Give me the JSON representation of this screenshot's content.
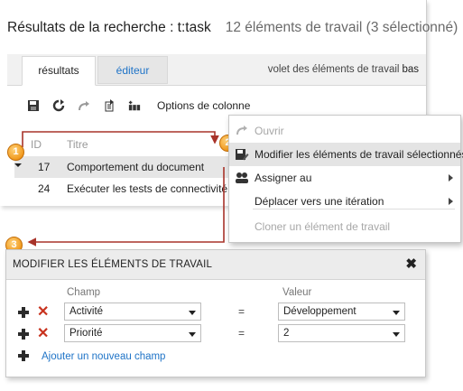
{
  "search": {
    "title": "Résultats de la recherche : t:task",
    "count": "12 éléments de travail (3 sélectionné)",
    "tabs": [
      {
        "label": "résultats"
      },
      {
        "label": "éditeur"
      }
    ],
    "pane_label": "volet des éléments de travail",
    "pane_value": "bas",
    "toolbar": {
      "column_options_label": "Options de colonne"
    },
    "grid": {
      "headers": {
        "id": "ID",
        "title": "Titre"
      },
      "rows": [
        {
          "id": "17",
          "title": "Comportement du document"
        },
        {
          "id": "24",
          "title": "Exécuter les tests de connectivité"
        }
      ]
    }
  },
  "callouts": [
    "1",
    "2",
    "3"
  ],
  "context_menu": {
    "items": [
      {
        "label": "Ouvrir",
        "icon": "open-icon"
      },
      {
        "label": "Modifier les éléments de travail sélectionnés...",
        "icon": "save-edit-icon"
      },
      {
        "label": "Assigner au",
        "icon": "people-icon"
      },
      {
        "label": "Déplacer vers une itération",
        "icon": ""
      },
      {
        "label": "Cloner un élément de travail",
        "icon": ""
      }
    ]
  },
  "dialog": {
    "title": "MODIFIER LES ÉLÉMENTS DE TRAVAIL",
    "headers": {
      "field": "Champ",
      "value": "Valeur"
    },
    "rows": [
      {
        "field": "Activité",
        "operator": "=",
        "value": "Développement"
      },
      {
        "field": "Priorité",
        "operator": "=",
        "value": "2"
      }
    ],
    "add_label": "Ajouter un nouveau champ"
  },
  "colors": {
    "accent_link": "#1e73c7",
    "callout_orange": "#f19a1e",
    "connector_red": "#a8332a",
    "delete_red": "#c8321e"
  }
}
